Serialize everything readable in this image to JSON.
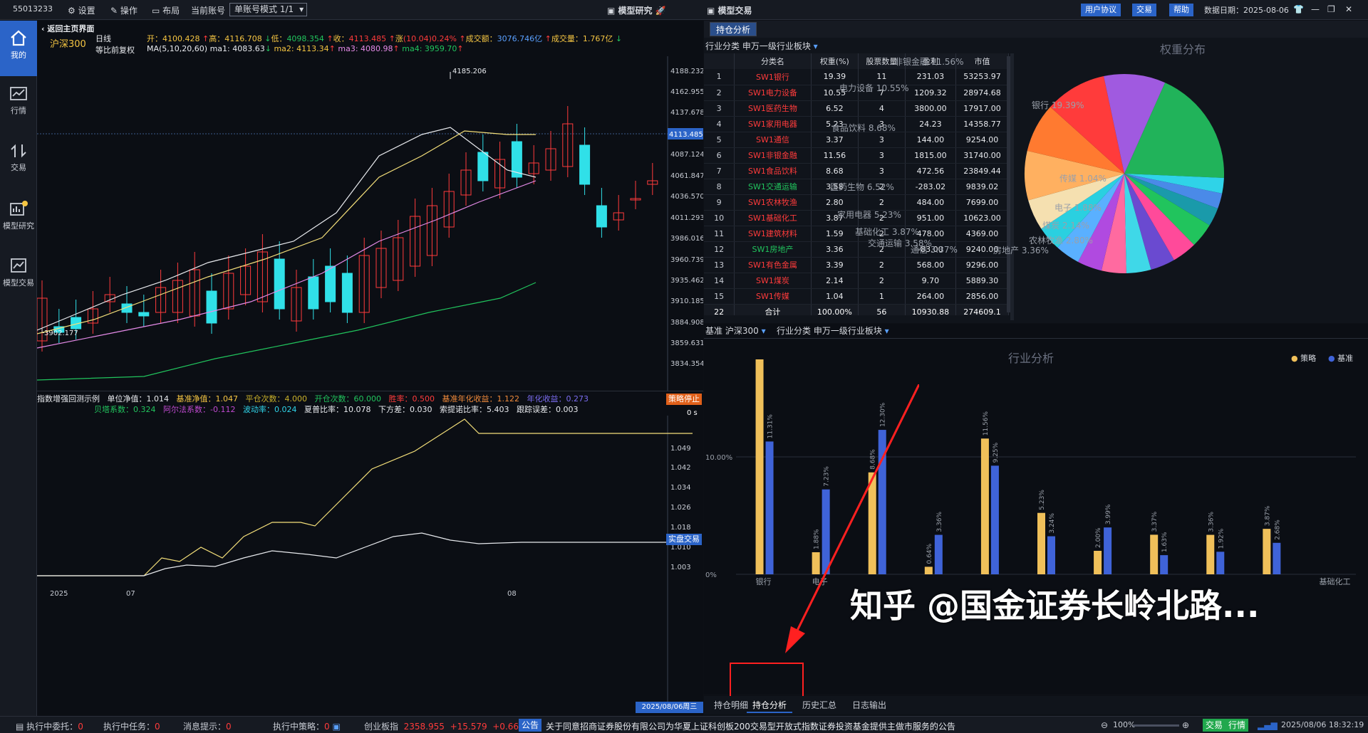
{
  "topbar": {
    "account_id": "55013233",
    "settings": "设置",
    "operate": "操作",
    "layout": "布局",
    "current_account_label": "当前账号",
    "account_mode": "单账号模式 1/1",
    "model_research": "模型研究",
    "model_trade": "模型交易",
    "user_agreement": "用户协议",
    "trade": "交易",
    "help": "帮助",
    "data_date": "数据日期：2025-08-06"
  },
  "sidebar": [
    {
      "label": "我的",
      "icon": "home-icon"
    },
    {
      "label": "行情",
      "icon": "chart-icon"
    },
    {
      "label": "交易",
      "icon": "transfer-icon"
    },
    {
      "label": "模型研究",
      "icon": "research-icon"
    },
    {
      "label": "模型交易",
      "icon": "model-trade-icon"
    }
  ],
  "kline": {
    "back": "返回主页界面",
    "index_name": "沪深300",
    "period": "日线",
    "adjust": "等比前复权",
    "open_label": "开：",
    "open": "4100.428",
    "high_label": "高：",
    "high": "4116.708",
    "low_label": "低：",
    "low": "4098.354",
    "close_label": "收：",
    "close": "4113.485",
    "change_label": "涨",
    "change": "(10.04)",
    "pct": "0.24%",
    "amount_label": "成交额：",
    "amount": "3076.746亿",
    "vol_label": "成交量：",
    "vol": "1.767亿",
    "ma_label": "MA(5,10,20,60)",
    "ma1_label": "ma1:",
    "ma1": "4083.63",
    "ma2_label": "ma2:",
    "ma2": "4113.34",
    "ma3_label": "ma3:",
    "ma3": "4080.98",
    "ma4_label": "ma4:",
    "ma4": "3959.70",
    "peak_label": "4185.206",
    "trough_label": "3902.177",
    "price_tag": "4113.485",
    "y_ticks": [
      "4188.232",
      "4162.955",
      "4137.678",
      "4113.485",
      "4087.124",
      "4061.847",
      "4036.570",
      "4011.293",
      "3986.016",
      "3960.739",
      "3935.462",
      "3910.185",
      "3884.908",
      "3859.631",
      "3834.354"
    ]
  },
  "backtest": {
    "title": "指数增强回测示例",
    "unit_nav_label": "单位净值：",
    "unit_nav": "1.014",
    "bench_nav_label": "基准净值：",
    "bench_nav": "1.047",
    "close_count_label": "平仓次数：",
    "close_count": "4.000",
    "open_count_label": "开仓次数：",
    "open_count": "60.000",
    "win_label": "胜率：",
    "win": "0.500",
    "bench_annual_label": "基准年化收益：",
    "bench_annual": "1.122",
    "annual_label": "年化收益：",
    "annual": "0.273",
    "beta_label": "贝塔系数：",
    "beta": "0.324",
    "alpha_label": "阿尔法系数：",
    "alpha": "-0.112",
    "vol_label": "波动率：",
    "vol": "0.024",
    "sharpe_label": "夏普比率：",
    "sharpe": "10.078",
    "down_label": "下方差：",
    "down": "0.030",
    "sortino_label": "索提诺比率：",
    "sortino": "5.403",
    "te_label": "跟踪误差：",
    "te": "0.003",
    "stop_btn": "策略停止",
    "time": "0 s",
    "live_btn": "实盘交易",
    "y_ticks": [
      "1.049",
      "1.042",
      "1.034",
      "1.026",
      "1.018",
      "1.010",
      "1.003"
    ],
    "x_labels": [
      "2025",
      "07",
      "08"
    ],
    "date_tag": "2025/08/06周三"
  },
  "holdings": {
    "tab": "持仓分析",
    "category_label": "行业分类",
    "category_value": "申万一级行业板块",
    "headers": [
      "",
      "分类名",
      "权重(%)",
      "股票数量",
      "盈利",
      "市值"
    ],
    "rows": [
      [
        "1",
        "SW1银行",
        "19.39",
        "11",
        "231.03",
        "53253.97"
      ],
      [
        "2",
        "SW1电力设备",
        "10.55",
        "7",
        "1209.32",
        "28974.68"
      ],
      [
        "3",
        "SW1医药生物",
        "6.52",
        "4",
        "3800.00",
        "17917.00"
      ],
      [
        "4",
        "SW1家用电器",
        "5.23",
        "3",
        "24.23",
        "14358.77"
      ],
      [
        "5",
        "SW1通信",
        "3.37",
        "3",
        "144.00",
        "9254.00"
      ],
      [
        "6",
        "SW1非银金融",
        "11.56",
        "3",
        "1815.00",
        "31740.00"
      ],
      [
        "7",
        "SW1食品饮料",
        "8.68",
        "3",
        "472.56",
        "23849.44"
      ],
      [
        "8",
        "SW1交通运输",
        "3.58",
        "2",
        "-283.02",
        "9839.02"
      ],
      [
        "9",
        "SW1农林牧渔",
        "2.80",
        "2",
        "484.00",
        "7699.00"
      ],
      [
        "10",
        "SW1基础化工",
        "3.87",
        "2",
        "951.00",
        "10623.00"
      ],
      [
        "11",
        "SW1建筑材料",
        "1.59",
        "2",
        "478.00",
        "4369.00"
      ],
      [
        "12",
        "SW1房地产",
        "3.36",
        "2",
        "-83.00",
        "9240.00"
      ],
      [
        "13",
        "SW1有色金属",
        "3.39",
        "2",
        "568.00",
        "9296.00"
      ],
      [
        "14",
        "SW1煤炭",
        "2.14",
        "2",
        "9.70",
        "5889.30"
      ],
      [
        "15",
        "SW1传媒",
        "1.04",
        "1",
        "264.00",
        "2856.00"
      ]
    ],
    "row_colors": [
      "red",
      "red",
      "red",
      "red",
      "red",
      "red",
      "red",
      "green",
      "red",
      "red",
      "red",
      "green",
      "red",
      "red",
      "red"
    ],
    "total": [
      "22",
      "合计",
      "100.00%",
      "56",
      "10930.88",
      "274609.1"
    ]
  },
  "pie": {
    "title": "权重分布",
    "labels": [
      {
        "text": "非银金融 11.56%"
      },
      {
        "text": "电力设备 10.55%"
      },
      {
        "text": "银行 19.39%"
      },
      {
        "text": "食品饮料 8.68%"
      },
      {
        "text": "传媒 1.04%"
      },
      {
        "text": "医药生物 6.52%"
      },
      {
        "text": "电子 1.88%"
      },
      {
        "text": "家用电器 5.23%"
      },
      {
        "text": "煤炭 2.14%"
      },
      {
        "text": "基础化工 3.87%"
      },
      {
        "text": "农林牧渔 2.80%"
      },
      {
        "text": "交通运输 3.58%"
      },
      {
        "text": "通信 3.37%"
      },
      {
        "text": "房地产 3.36%"
      }
    ]
  },
  "chart_data": {
    "type": "bar",
    "title": "行业分析",
    "categories": [
      "银行",
      "电子",
      "",
      "",
      "",
      "",
      "",
      "",
      "",
      "",
      "基础化工"
    ],
    "series": [
      {
        "name": "策略",
        "color": "#f0c05a",
        "values": [
          19.39,
          1.88,
          8.68,
          0.64,
          11.56,
          5.23,
          2.0,
          3.37,
          3.36,
          3.87,
          null
        ]
      },
      {
        "name": "基准",
        "color": "#3f63d8",
        "values": [
          11.31,
          7.23,
          12.3,
          3.36,
          9.25,
          3.24,
          3.99,
          1.63,
          1.92,
          2.68,
          null
        ]
      }
    ],
    "ylim": [
      0,
      20
    ],
    "y_ticks": [
      "20.00%",
      "10.00%",
      "0%"
    ]
  },
  "industry": {
    "bench_label": "基准",
    "bench_value": "沪深300",
    "cat_label": "行业分类",
    "cat_value": "申万一级行业板块",
    "legend_strategy": "策略",
    "legend_bench": "基准",
    "watermark": "知乎 @国金证券长岭北路..."
  },
  "bottom_tabs": [
    "持仓明细",
    "持仓分析",
    "历史汇总",
    "日志输出"
  ],
  "status": {
    "exec_commission_label": "执行中委托：",
    "exec_commission": "0",
    "exec_task_label": "执行中任务：",
    "exec_task": "0",
    "msg_label": "消息提示：",
    "msg": "0",
    "exec_strategy_label": "执行中策略：",
    "exec_strategy": "0",
    "index_name": "创业板指",
    "index_value": "2358.955",
    "index_change": "+15.579",
    "index_pct": "+0.66%",
    "notice_tag": "公告",
    "notice": "关于同意招商证券股份有限公司为华夏上证科创板200交易型开放式指数证券投资基金提供主做市服务的公告",
    "zoom": "100%",
    "trade_btn": "交易",
    "quote_btn": "行情",
    "datetime": "2025/08/06 18:32:19"
  }
}
